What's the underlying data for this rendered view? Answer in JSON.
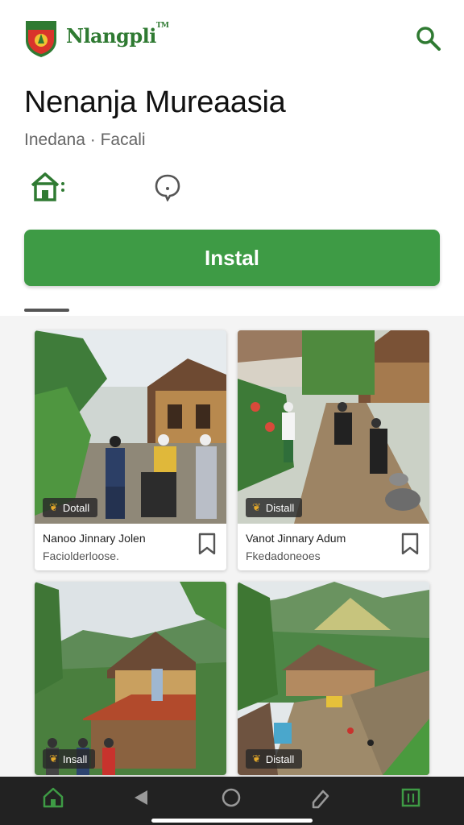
{
  "header": {
    "brand": "Nlangpli",
    "brand_mark": "TM",
    "logo_icon": "shield-logo-icon",
    "search_icon": "search-icon"
  },
  "app": {
    "title": "Nenanja Mureaasia",
    "subtitle": "Inedana · Facali"
  },
  "actions": {
    "home_icon": "home-icon",
    "chat_icon": "chat-bubble-icon",
    "install_label": "Instal"
  },
  "cards": [
    {
      "badge": "Dotall",
      "title": "Nanoo Jinnary Jolen",
      "subtitle": "Faciolderloose."
    },
    {
      "badge": "Distall",
      "title": "Vanot Jinnary Adum",
      "subtitle": "Fkedadoneoes"
    },
    {
      "badge": "Insall",
      "title": "",
      "subtitle": ""
    },
    {
      "badge": "Distall",
      "title": "",
      "subtitle": ""
    }
  ],
  "bottom_nav": [
    "home-icon",
    "back-icon",
    "circle-home-icon",
    "edit-icon",
    "recent-apps-icon"
  ],
  "colors": {
    "accent": "#3e9b45",
    "brand": "#2f7a32",
    "nav_bg": "#222222"
  }
}
